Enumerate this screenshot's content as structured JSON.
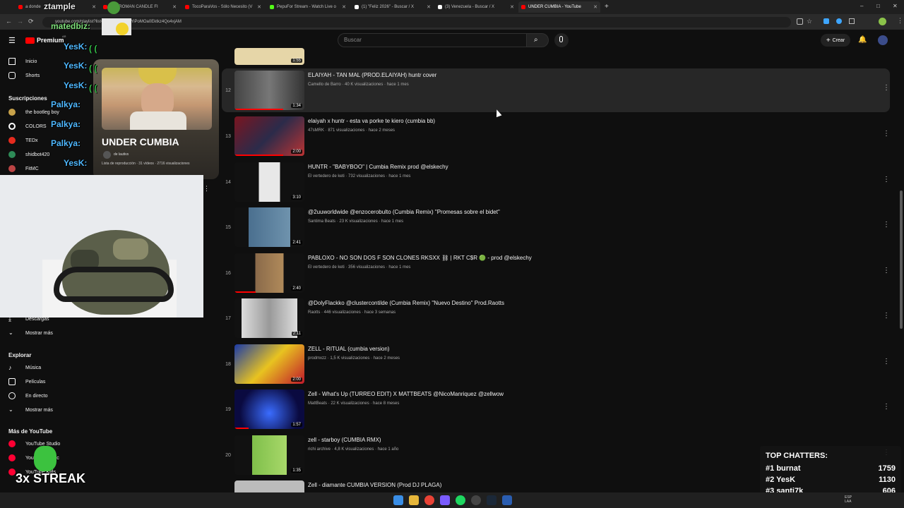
{
  "browser": {
    "tabs": [
      {
        "label": "a donde",
        "color": "#ff0000"
      },
      {
        "label": "ION ROMAN CANDLE FI",
        "color": "#ff0000"
      },
      {
        "label": "TocoParaVos - Sólo Necesito (V",
        "color": "#ff0000"
      },
      {
        "label": "PepuFor Stream - Watch Live o",
        "color": "#53fc18"
      },
      {
        "label": "(1) \"Feliz 2026\" - Buscar / X",
        "color": "#ffffff"
      },
      {
        "label": "(3) Venezuela - Buscar / X",
        "color": "#ffffff"
      },
      {
        "label": "UNDER CUMBIA - YouTube",
        "color": "#ff0000"
      }
    ],
    "url": "youtube.com/playlist?list=PLVxx...amZ-xYiPoMOa0Ektkz4Qo4xjAM"
  },
  "youtube": {
    "logo": "Premium",
    "logo_sup": "AR",
    "search_placeholder": "Buscar",
    "create_label": "Crear",
    "sidebar": {
      "home": "Inicio",
      "shorts": "Shorts",
      "subs_heading": "Suscripciones",
      "subs": [
        "the bootleg boy",
        "COLORS",
        "TEDx",
        "shidbot420",
        "FitMC"
      ],
      "downloads": "Descargas",
      "show_more": "Mostrar más",
      "explore_heading": "Explorar",
      "explore": [
        "Música",
        "Películas",
        "En directo"
      ],
      "show_more2": "Mostrar más",
      "more_heading": "Más de YouTube",
      "more": [
        "YouTube Studio",
        "YouTube Music",
        "YouTube Kids"
      ]
    },
    "playlist": {
      "title": "UNDER CUMBIA",
      "owner": "de lautivs",
      "meta": "Lista de reproducción · 31 vídeos · 2716 visualizaciones"
    },
    "videos": [
      {
        "idx": "",
        "title": "",
        "meta": "",
        "dur": "1:55",
        "progress": 0
      },
      {
        "idx": "12",
        "title": "ELAIYAH - TAN MAL (PROD.ELAIYAH) huntr cover",
        "meta": "Camello de Barro · 40 K visualizaciones · hace 1 mes",
        "dur": "1:34",
        "progress": 0.7
      },
      {
        "idx": "13",
        "title": "elaiyah x huntr - esta va porke te kiero (cumbia bb)",
        "meta": "47sMRK · 871 visualizaciones · hace 2 meses",
        "dur": "2:00",
        "progress": 0.7
      },
      {
        "idx": "14",
        "title": "HUNTR - \"BABYBOO\" | Cumbia Remix prod @elskechy",
        "meta": "El vertedero de keti · 732 visualizaciones · hace 1 mes",
        "dur": "3:10",
        "progress": 0
      },
      {
        "idx": "15",
        "title": "@2uuworldwide @enzocerobulto (Cumbia Remix) \"Promesas sobre el bidet\"",
        "meta": "Santima Beats · 23 K visualizaciones · hace 1 mes",
        "dur": "2:41",
        "progress": 0
      },
      {
        "idx": "16",
        "title": "PABLOXO - NO SON DOS F SON CLONES RKSXX ⛓ | RKT C$R 🟢 - prod @elskechy",
        "meta": "El vertedero de keti · 356 visualizaciones · hace 1 mes",
        "dur": "2:40",
        "progress": 0.3
      },
      {
        "idx": "17",
        "title": " @DolyFlackko @clustercontilde (Cumbia Remix) \"Nuevo Destino\" Prod.Raotts",
        "meta": "Raotts · 446 visualizaciones · hace 3 semanas",
        "dur": "2:11",
        "progress": 0
      },
      {
        "idx": "18",
        "title": "ZELL - RITUAL (cumbia version)",
        "meta": "prodmxzz · 1,5 K visualizaciones · hace 2 meses",
        "dur": "2:00",
        "progress": 0
      },
      {
        "idx": "19",
        "title": "Zell - What's Up (TURREO EDIT) X MATTBEATS @NicoManriquez @zellwow",
        "meta": "MattBeats · 22 K visualizaciones · hace 8 meses",
        "dur": "1:57",
        "progress": 0.2
      },
      {
        "idx": "20",
        "title": "zell - starboy (CUMBIA RMX)",
        "meta": "richi archive · 4,8 K visualizaciones · hace 1 año",
        "dur": "1:35",
        "progress": 0
      },
      {
        "idx": "",
        "title": "Zell - diamante CUMBIA VERSION (Prod DJ PLAGA)",
        "meta": "",
        "dur": "",
        "progress": 0
      }
    ]
  },
  "overlay": {
    "chat_top_user": "matedbiz:",
    "chat_top_word": "ztample",
    "yesk": "YesK:",
    "palkya": "Palkya:",
    "streak": "3x STREAK",
    "top_chatters_title": "TOP CHATTERS:",
    "top_chatters": [
      {
        "rank": "#1",
        "name": "burnat",
        "count": "1759"
      },
      {
        "rank": "#2",
        "name": "YesK",
        "count": "1130"
      },
      {
        "rank": "#3",
        "name": "santi7k",
        "count": "606"
      }
    ]
  },
  "taskbar": {
    "lang": "ESP\nLAA"
  }
}
